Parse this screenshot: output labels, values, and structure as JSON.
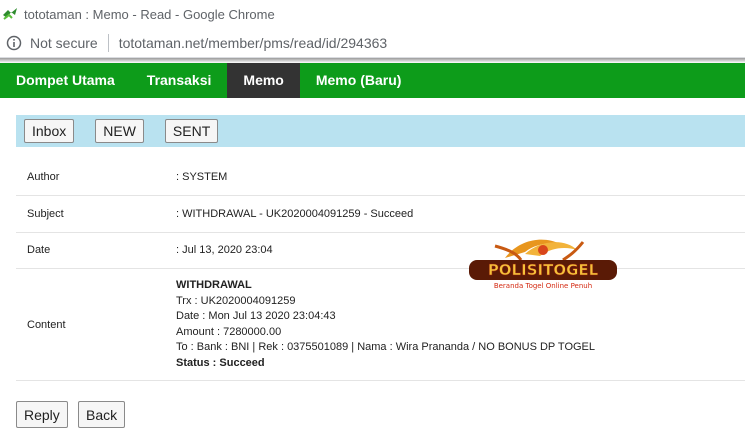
{
  "browser": {
    "window_title": "tototaman : Memo - Read - Google Chrome",
    "security_label": "Not secure",
    "url": "tototaman.net/member/pms/read/id/294363"
  },
  "nav": {
    "items": [
      {
        "label": "Dompet Utama",
        "active": false
      },
      {
        "label": "Transaksi",
        "active": false
      },
      {
        "label": "Memo",
        "active": true
      },
      {
        "label": "Memo (Baru)",
        "active": false
      }
    ]
  },
  "folders": {
    "inbox": "Inbox",
    "new": "NEW",
    "sent": "SENT"
  },
  "memo": {
    "author_label": "Author",
    "author_value": ": SYSTEM",
    "subject_label": "Subject",
    "subject_value": ": WITHDRAWAL - UK2020004091259 - Succeed",
    "date_label": "Date",
    "date_value": ": Jul 13, 2020 23:04",
    "content_label": "Content",
    "content_lines": [
      "WITHDRAWAL",
      "Trx : UK2020004091259",
      "Date : Mon Jul 13 2020 23:04:43",
      "Amount : 7280000.00",
      "To : Bank : BNI | Rek : 0375501089 | Nama : Wira Prananda / NO BONUS DP TOGEL",
      "Status : Succeed"
    ]
  },
  "actions": {
    "reply": "Reply",
    "back": "Back"
  },
  "watermark": {
    "name": "POLISITOGEL",
    "tagline": "Beranda Togel Online Penuh"
  },
  "colors": {
    "nav_green": "#0d9c1a",
    "nav_active": "#333333",
    "folder_bar": "#b9e2f0"
  }
}
